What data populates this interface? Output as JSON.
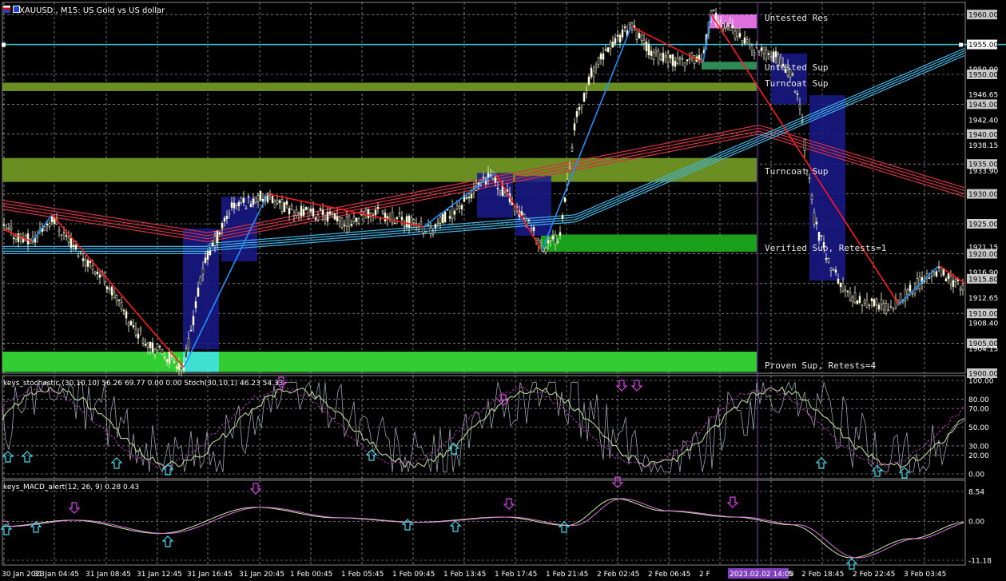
{
  "header": {
    "title": "XAUUSD., M15:  US Gold vs US dollar"
  },
  "indicators": {
    "stoch_label": "keys_stochastic (30,10,10) 56.26 69.77 0.00 0.00 Stoch(30,10,1) 46.23 54.33",
    "macd_label": "keys_MACD_alert(12, 26, 9) 0.28 0.43"
  },
  "zones": [
    {
      "name": "untested-res",
      "label": "Untested Res"
    },
    {
      "name": "untested-sup",
      "label": "Untested Sup"
    },
    {
      "name": "turncoat-sup-1",
      "label": "Turncoat Sup"
    },
    {
      "name": "turncoat-sup-2",
      "label": "Turncoat Sup"
    },
    {
      "name": "verified-sup",
      "label": "Verified Sup, Retests=1"
    },
    {
      "name": "proven-sup",
      "label": "Proven Sup, Retests=4"
    }
  ],
  "price_axis": [
    "1960.00",
    "1955.00",
    "1950.90",
    "1950.00",
    "1946.65",
    "1945.00",
    "1942.40",
    "1940.00",
    "1938.15",
    "1935.00",
    "1933.90",
    "1930.00",
    "1925.00",
    "1921.15",
    "1920.00",
    "1916.90",
    "1915.80",
    "1912.65",
    "1910.00",
    "1908.40",
    "1905.00",
    "1904.15",
    "1900.00"
  ],
  "stoch_axis": [
    "100.00",
    "80.00",
    "70.00",
    "50.00",
    "30.00",
    "20.00",
    "0.00"
  ],
  "macd_axis": [
    "8.54",
    "0.00",
    "-11.18"
  ],
  "time_axis": [
    "30 Jan 2023",
    "31 Jan 04:45",
    "31 Jan 08:45",
    "31 Jan 12:45",
    "31 Jan 16:45",
    "31 Jan 20:45",
    "1 Feb 00:45",
    "1 Feb 05:45",
    "1 Feb 09:45",
    "1 Feb 13:45",
    "1 Feb 17:45",
    "1 Feb 21:45",
    "2 Feb 02:45",
    "2 Feb 06:45",
    "2 F",
    "2 Feb 14:45",
    "2 Feb 18:45",
    "2 Feb 22:45",
    "3 Feb 03:45"
  ],
  "crosshair_time": "2023.02.02 14:00",
  "colors": {
    "bg": "#000000",
    "grid": "#c0c0c0",
    "candle": "#ffffe0",
    "zigzag_red": "#ff1a1a",
    "zigzag_blue": "#1e90ff",
    "ma_red": "#d23246",
    "ma_blue": "#3fb4e6",
    "zone_olive": "#6b8e23",
    "zone_green": "#32cd32",
    "zone_pink": "#e070e0",
    "box_navy": "#1a1a8c",
    "cyan_line": "#38d0e0",
    "crosshair": "#8040c0"
  }
}
